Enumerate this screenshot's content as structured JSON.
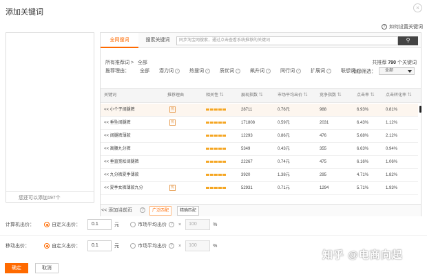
{
  "dialog": {
    "title": "添加关键词",
    "close_icon": "×"
  },
  "help": {
    "label": "如何设置关键词"
  },
  "left_panel": {
    "hint": "您还可以添加197个"
  },
  "tabs": [
    {
      "label": "全网搜词",
      "active": true
    },
    {
      "label": "搜索关键词",
      "active": false
    }
  ],
  "search": {
    "placeholder": "同步淘宝网搜索，通过点击查看系统推荐的关键词",
    "button_icon": "search-icon"
  },
  "crumb": {
    "label": "所有推荐词 >",
    "value": "全部"
  },
  "total": {
    "prefix": "共推荐",
    "count": "790",
    "suffix": "个关键词"
  },
  "filter": {
    "label": "推荐理由：",
    "options": [
      "全部",
      "潜力词",
      "热搜词",
      "质优词",
      "飙升词",
      "同行词",
      "扩展词",
      "联想词"
    ],
    "index_label": "指标筛选：",
    "index_value": "全部"
  },
  "table": {
    "headers": [
      "关键词",
      "推荐理由",
      "相关性",
      "展现指数",
      "市场平均出价",
      "竞争指数",
      "点击率",
      "点击转化率"
    ],
    "rows": [
      {
        "keyword": "<< 小个子阔腿裤",
        "reason": "热",
        "show_index": "28711",
        "avg_bid": "0.76元",
        "competition": "988",
        "ctr": "6.93%",
        "cvr": "0.81%",
        "highlight": true
      },
      {
        "keyword": "<< 垂坠阔腿裤",
        "reason": "热",
        "show_index": "171808",
        "avg_bid": "0.59元",
        "competition": "2031",
        "ctr": "6.43%",
        "cvr": "1.12%",
        "highlight": false
      },
      {
        "keyword": "<< 阔腿裤薄款",
        "reason": "",
        "show_index": "12293",
        "avg_bid": "0.86元",
        "competition": "476",
        "ctr": "5.68%",
        "cvr": "2.12%",
        "highlight": false
      },
      {
        "keyword": "<< 高腰九分裤",
        "reason": "",
        "show_index": "5349",
        "avg_bid": "0.43元",
        "competition": "355",
        "ctr": "6.63%",
        "cvr": "0.94%",
        "highlight": false
      },
      {
        "keyword": "<< 垂直宽松阔腿裤",
        "reason": "",
        "show_index": "22267",
        "avg_bid": "0.74元",
        "competition": "475",
        "ctr": "6.16%",
        "cvr": "1.06%",
        "highlight": false
      },
      {
        "keyword": "<< 九分裤夏季薄款",
        "reason": "",
        "show_index": "3920",
        "avg_bid": "1.38元",
        "competition": "295",
        "ctr": "4.71%",
        "cvr": "1.82%",
        "highlight": false
      },
      {
        "keyword": "<< 夏季女裤薄款九分",
        "reason": "热",
        "show_index": "52931",
        "avg_bid": "0.71元",
        "competition": "1294",
        "ctr": "5.71%",
        "cvr": "1.93%",
        "highlight": false
      }
    ]
  },
  "footer": {
    "add_page": "<< 添加当前页",
    "match_broad": "广泛匹配",
    "match_exact": "精确匹配"
  },
  "bids": [
    {
      "label": "计算机出价：",
      "custom": "自定义出价：",
      "value": "0.1",
      "unit": "元",
      "market": "市场平均出价",
      "pct": "100",
      "pct_unit": "%"
    },
    {
      "label": "移动出价：",
      "custom": "自定义出价：",
      "value": "0.1",
      "unit": "元",
      "market": "市场平均出价",
      "pct": "100",
      "pct_unit": "%"
    }
  ],
  "actions": {
    "ok": "确定",
    "cancel": "取消"
  },
  "watermark": "知乎 @电商向起"
}
